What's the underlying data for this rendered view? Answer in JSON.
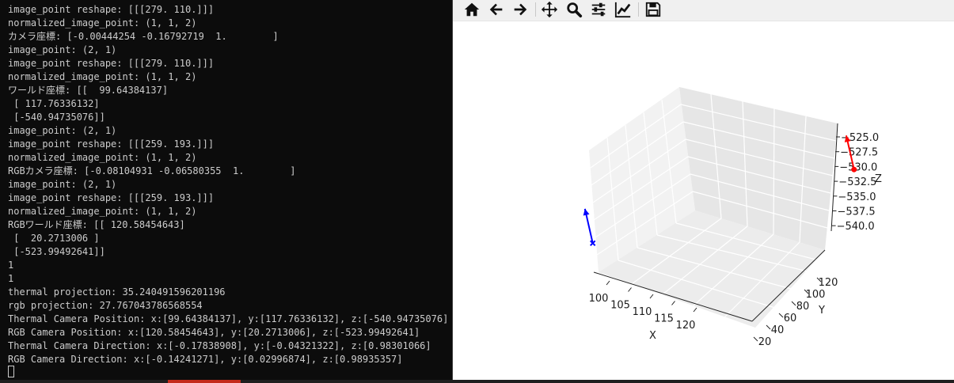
{
  "terminal": {
    "lines": [
      "image_point reshape: [[[279. 110.]]]",
      "normalized_image_point: (1, 1, 2)",
      "カメラ座標: [-0.00444254 -0.16792719  1.        ]",
      "image_point: (2, 1)",
      "image_point reshape: [[[279. 110.]]]",
      "normalized_image_point: (1, 1, 2)",
      "ワールド座標: [[  99.64384137]",
      " [ 117.76336132]",
      " [-540.94735076]]",
      "image_point: (2, 1)",
      "image_point reshape: [[[259. 193.]]]",
      "normalized_image_point: (1, 1, 2)",
      "RGBカメラ座標: [-0.08104931 -0.06580355  1.        ]",
      "image_point: (2, 1)",
      "image_point reshape: [[[259. 193.]]]",
      "normalized_image_point: (1, 1, 2)",
      "RGBワールド座標: [[ 120.58454643]",
      " [  20.2713006 ]",
      " [-523.99492641]]",
      "1",
      "1",
      "thermal projection: 35.240491596201196",
      "rgb projection: 27.767043786568554",
      "Thermal Camera Position: x:[99.64384137], y:[117.76336132], z:[-540.94735076]",
      "RGB Camera Position: x:[120.58454643], y:[20.2713006], z:[-523.99492641]",
      "Thermal Camera Direction: x:[-0.17838908], y:[-0.04321322], z:[0.98301066]",
      "RGB Camera Direction: x:[-0.14241271], y:[0.02996874], z:[0.98935357]"
    ]
  },
  "toolbar": {
    "icons": [
      "home-icon",
      "back-arrow-icon",
      "forward-arrow-icon",
      "pan-icon",
      "zoom-icon",
      "subplots-icon",
      "edit-axis-icon",
      "save-icon"
    ]
  },
  "chart_data": {
    "type": "scatter",
    "projection": "3d",
    "xlabel": "X",
    "ylabel": "Y",
    "zlabel": "Z",
    "x_ticks": [
      "100",
      "105",
      "110",
      "115",
      "120"
    ],
    "y_ticks": [
      "20",
      "40",
      "60",
      "80",
      "100",
      "120"
    ],
    "z_ticks": [
      "−525.0",
      "−527.5",
      "−530.0",
      "−532.5",
      "−535.0",
      "−537.5",
      "−540.0"
    ],
    "xlim": [
      99.6,
      120.6
    ],
    "ylim": [
      20.3,
      117.8
    ],
    "zlim": [
      -541,
      -524
    ],
    "grid": true,
    "series": [
      {
        "marker": "x",
        "color": "#0000ff",
        "x": 99.64384137,
        "y": 117.76336132,
        "z": -540.94735076,
        "direction": [
          -0.17838908,
          -0.04321322,
          0.98301066
        ]
      },
      {
        "marker": "o",
        "color": "#ff0000",
        "x": 120.58454643,
        "y": 20.2713006,
        "z": -523.99492641,
        "direction": [
          -0.14241271,
          0.02996874,
          0.98935357
        ]
      }
    ]
  }
}
